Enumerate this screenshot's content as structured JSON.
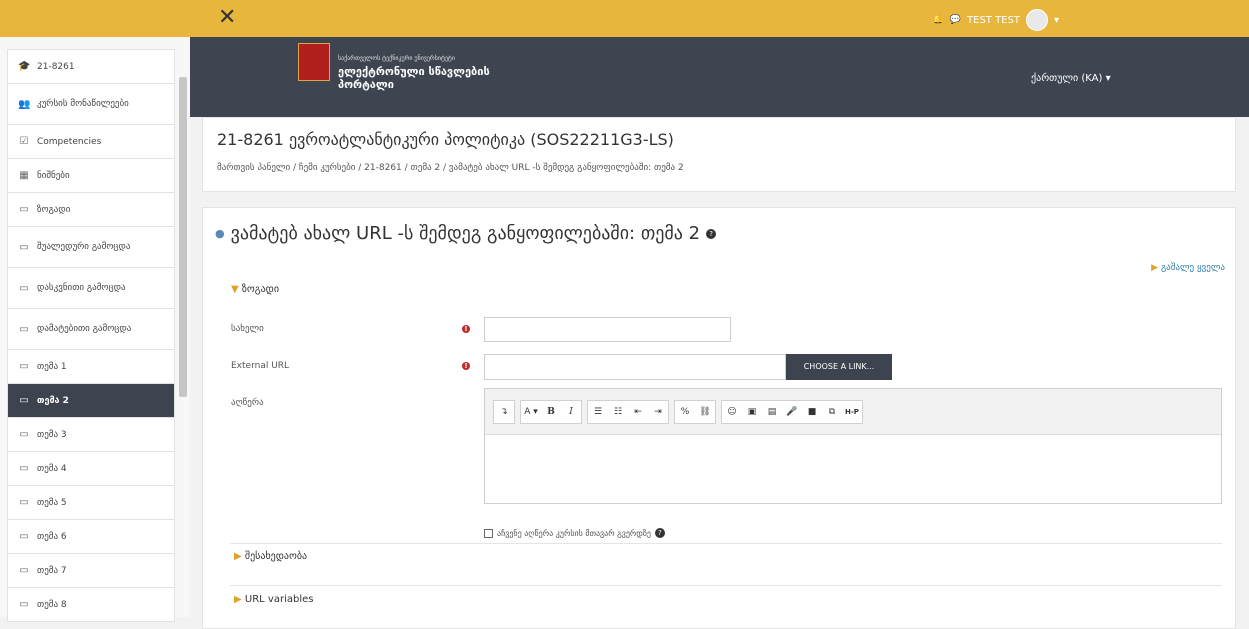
{
  "topbar": {
    "close": "✕",
    "bell": "🔔",
    "chat": "💬",
    "user": "TEST TEST",
    "caret": "▾"
  },
  "sidebar": {
    "items": [
      {
        "icon": "🎓",
        "label": "21-8261"
      },
      {
        "icon": "👥",
        "label": "კურსის მონაწილეები"
      },
      {
        "icon": "☑",
        "label": "Competencies"
      },
      {
        "icon": "▦",
        "label": "ნიშნები"
      },
      {
        "icon": "▭",
        "label": "ზოგადი"
      },
      {
        "icon": "▭",
        "label": "შუალედური გამოცდა"
      },
      {
        "icon": "▭",
        "label": "დასკვნითი გამოცდა"
      },
      {
        "icon": "▭",
        "label": "დამატებითი გამოცდა"
      },
      {
        "icon": "▭",
        "label": "თემა 1"
      },
      {
        "icon": "▭",
        "label": "თემა 2"
      },
      {
        "icon": "▭",
        "label": "თემა 3"
      },
      {
        "icon": "▭",
        "label": "თემა 4"
      },
      {
        "icon": "▭",
        "label": "თემა 5"
      },
      {
        "icon": "▭",
        "label": "თემა 6"
      },
      {
        "icon": "▭",
        "label": "თემა 7"
      },
      {
        "icon": "▭",
        "label": "თემა 8"
      }
    ]
  },
  "header": {
    "logo_small": "საქართველოს ტექნიკური უნივერსიტეტი",
    "logo_line1": "ელექტრონული სწავლების",
    "logo_line2": "პორტალი",
    "language": "ქართული (KA) ▾"
  },
  "course": {
    "title": "21-8261 ევროატლანტიკური პოლიტიკა (SOS22211G3-LS)",
    "breadcrumb": "მართვის პანელი  /  ჩემი კურსები  /  21-8261  /  თემა 2  /  ვამატებ ახალ URL -ს შემდეგ განყოფილებაში: თემა 2"
  },
  "form": {
    "heading": "ვამატებ ახალ URL -ს შემდეგ განყოფილებაში: თემა 2",
    "expand_all": "გაშალე ყველა",
    "section_general": "ზოგადი",
    "name_label": "სახელი",
    "url_label": "External URL",
    "choose_link": "CHOOSE A LINK...",
    "description_label": "აღწერა",
    "show_desc": "აჩვენე აღწერა კურსის მთავარ გვერდზე",
    "section_appearance": "შესახედაობა",
    "section_url_vars": "URL variables",
    "name_value": "",
    "url_value": ""
  },
  "editor_toolbar": {
    "group1": [
      "↴"
    ],
    "group2": [
      "A ▾",
      "B",
      "I"
    ],
    "group3": [
      "☰",
      "☷",
      "⇤",
      "⇥"
    ],
    "group4": [
      "%",
      "⛓"
    ],
    "group5": [
      "☺",
      "▣",
      "▤",
      "🎤",
      "■",
      "⧉",
      "H-P"
    ]
  }
}
